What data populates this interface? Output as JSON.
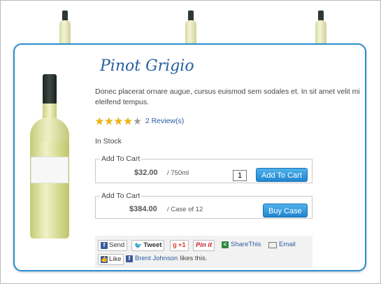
{
  "product": {
    "title": "Pinot Grigio",
    "description": "Donec placerat ornare augue, cursus euismod sem sodales et. In sit amet velit mi eleifend tempus.",
    "rating": 4,
    "rating_max": 5,
    "reviews_label": "2 Review(s)",
    "stock_status": "In Stock"
  },
  "cart_options": [
    {
      "legend": "Add To Cart",
      "price": "$32.00",
      "unit": "/ 750ml",
      "quantity": "1",
      "button": "Add To Cart"
    },
    {
      "legend": "Add To Cart",
      "price": "$384.00",
      "unit": "/ Case of 12",
      "button": "Buy Case"
    }
  ],
  "social": {
    "send": "Send",
    "tweet": "Tweet",
    "gplus": "+1",
    "pinit": "Pin it",
    "sharethis": "ShareThis",
    "email": "Email",
    "like": "Like",
    "liker_name": "Brent Johnson",
    "likes_text": "likes this."
  },
  "colors": {
    "accent": "#2b8fd0",
    "title": "#25609e",
    "button": "#1f86cf",
    "star": "#f2b705"
  },
  "icons": [
    "facebook-icon",
    "twitter-icon",
    "google-plus-icon",
    "pinterest-icon",
    "sharethis-icon",
    "email-icon",
    "star-icon"
  ]
}
